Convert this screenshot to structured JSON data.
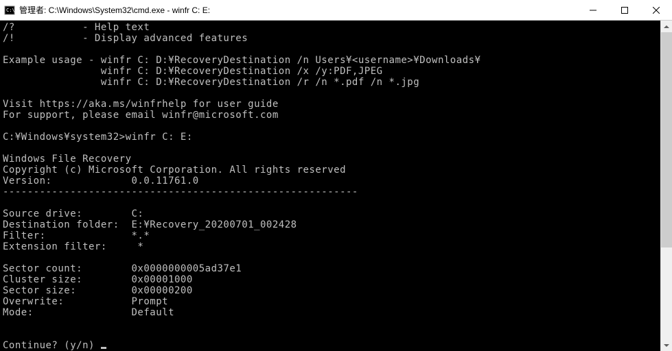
{
  "titlebar": {
    "title": "管理者: C:\\Windows\\System32\\cmd.exe - winfr  C: E:"
  },
  "terminal": {
    "lines": [
      "/?           - Help text",
      "/!           - Display advanced features",
      "",
      "Example usage - winfr C: D:\\RecoveryDestination /n Users\\<username>\\Downloads\\",
      "                winfr C: D:\\RecoveryDestination /x /y:PDF,JPEG",
      "                winfr C: D:\\RecoveryDestination /r /n *.pdf /n *.jpg",
      "",
      "Visit https://aka.ms/winfrhelp for user guide",
      "For support, please email winfr@microsoft.com",
      "",
      "C:\\Windows\\system32>winfr C: E:",
      "",
      "Windows File Recovery",
      "Copyright (c) Microsoft Corporation. All rights reserved",
      "Version:             0.0.11761.0",
      "----------------------------------------------------------",
      "",
      "Source drive:        C:",
      "Destination folder:  E:\\Recovery_20200701_002428",
      "Filter:              *.*",
      "Extension filter:     *",
      "",
      "Sector count:        0x0000000005ad37e1",
      "Cluster size:        0x00001000",
      "Sector size:         0x00000200",
      "Overwrite:           Prompt",
      "Mode:                Default",
      "",
      "",
      "Continue? (y/n) "
    ]
  }
}
